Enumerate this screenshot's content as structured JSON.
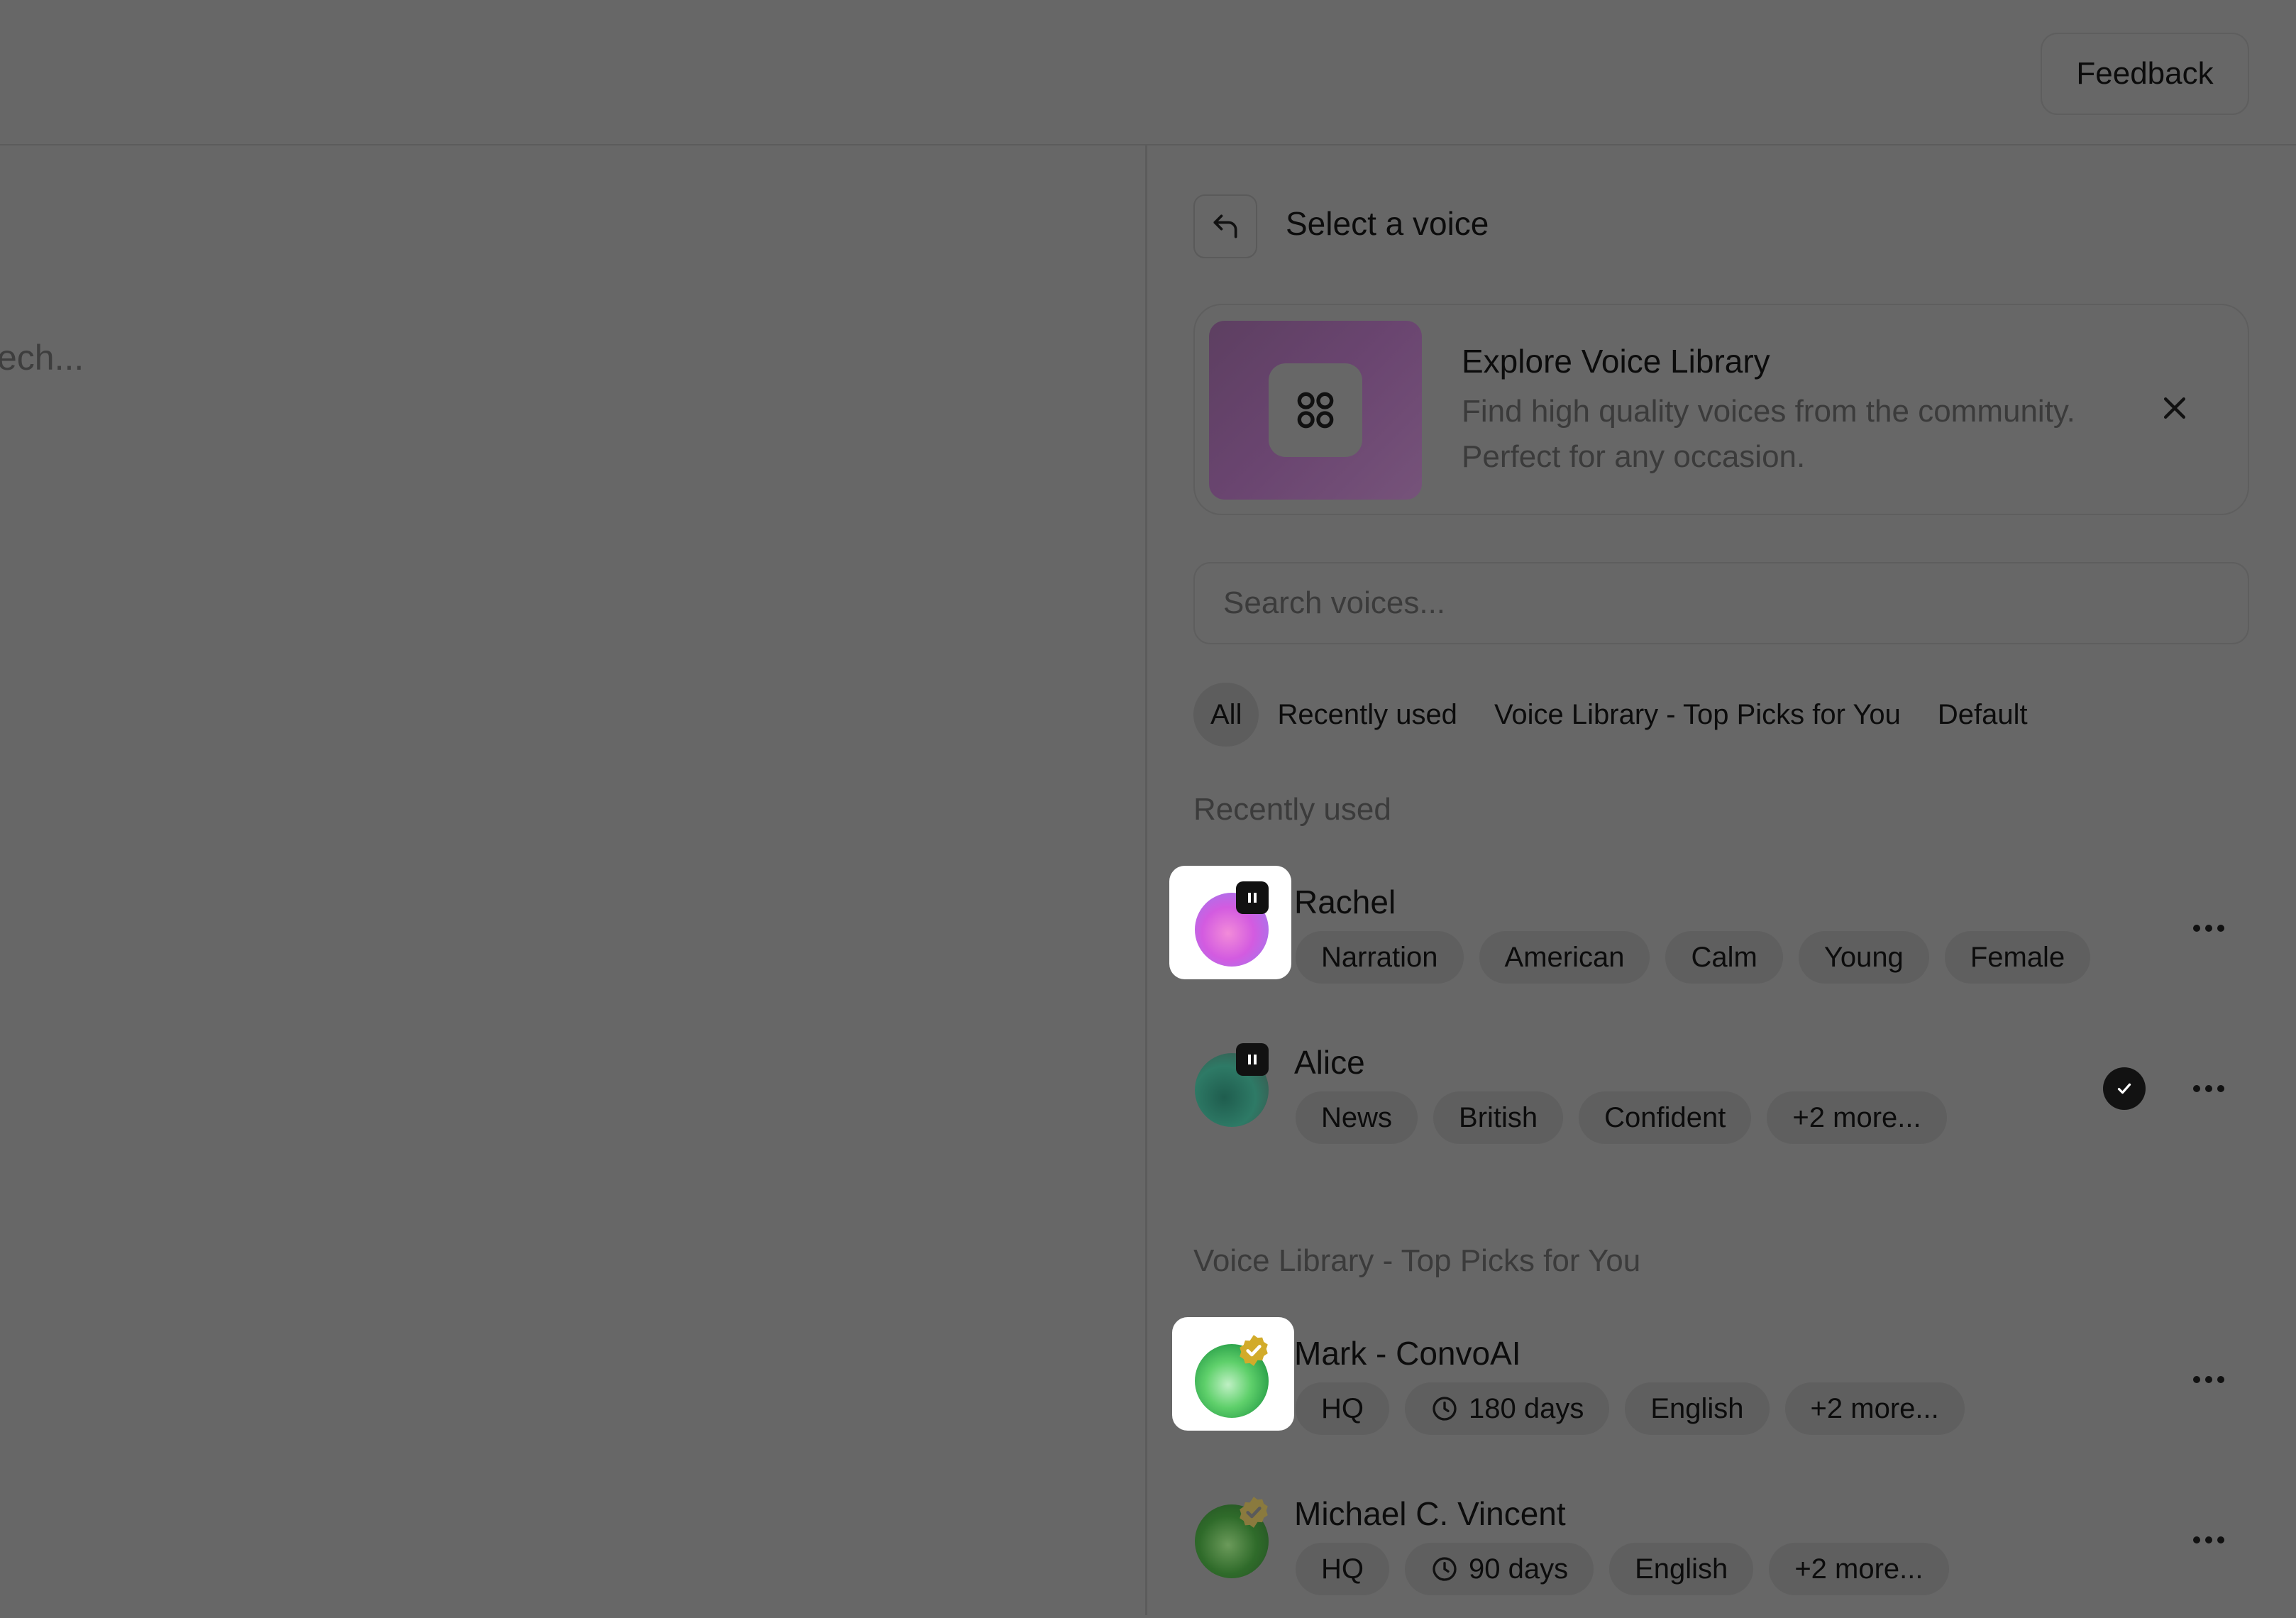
{
  "header": {
    "feedback_label": "Feedback"
  },
  "editor": {
    "placeholder_fragment": "ech..."
  },
  "panel": {
    "title": "Select a voice",
    "promo": {
      "title": "Explore Voice Library",
      "description": "Find high quality voices from the community. Perfect for any occasion."
    },
    "search": {
      "placeholder": "Search voices..."
    },
    "tabs": [
      {
        "label": "All",
        "active": true
      },
      {
        "label": "Recently used"
      },
      {
        "label": "Voice Library - Top Picks for You"
      },
      {
        "label": "Default"
      }
    ],
    "sections": [
      {
        "label": "Recently used",
        "voices": [
          {
            "name": "Rachel",
            "tags": [
              "Narration",
              "American",
              "Calm",
              "Young",
              "Female"
            ],
            "selected": false,
            "badge": "pause-icon"
          },
          {
            "name": "Alice",
            "tags": [
              "News",
              "British",
              "Confident",
              "+2 more..."
            ],
            "selected": true,
            "badge": "pause-icon"
          }
        ]
      },
      {
        "label": "Voice Library - Top Picks for You",
        "voices": [
          {
            "name": "Mark - ConvoAI",
            "tags": [
              "HQ",
              "180 days",
              "English",
              "+2 more..."
            ],
            "badge": "verified-icon"
          },
          {
            "name": "Michael C. Vincent",
            "tags": [
              "HQ",
              "90 days",
              "English",
              "+2 more..."
            ],
            "badge": "verified-icon"
          }
        ]
      }
    ]
  },
  "colors": {
    "overlay": "#676767",
    "accent_gold": "#c9a227",
    "promo_purple": "#6a4570"
  }
}
